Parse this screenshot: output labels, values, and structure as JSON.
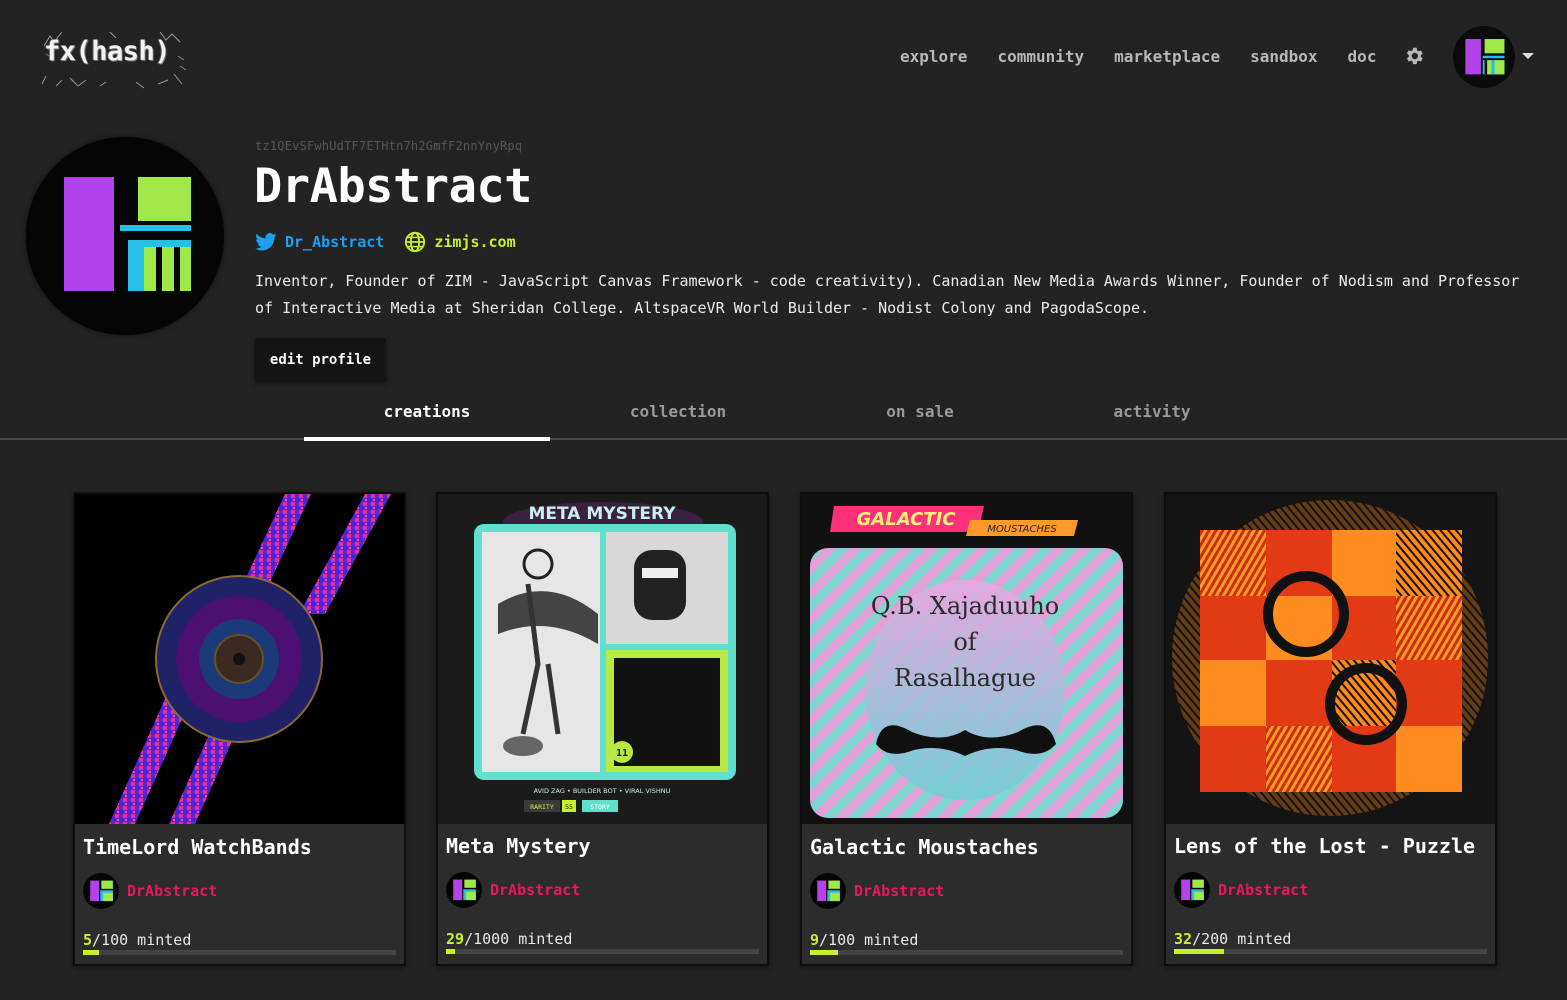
{
  "header": {
    "logo_text": "fx(hash)",
    "nav": [
      "explore",
      "community",
      "marketplace",
      "sandbox",
      "doc"
    ]
  },
  "profile": {
    "address": "tz1QEvSFwhUdTF7ETHtn7h2GmfF2nnYnyRpq",
    "name": "DrAbstract",
    "twitter": "Dr_Abstract",
    "website": "zimjs.com",
    "bio": "Inventor, Founder of ZIM - JavaScript Canvas Framework - code creativity). Canadian New Media Awards Winner, Founder of Nodism and Professor of Interactive Media at Sheridan College. AltspaceVR World Builder - Nodist Colony and PagodaScope.",
    "edit_label": "edit profile"
  },
  "tabs": [
    "creations",
    "collection",
    "on sale",
    "activity"
  ],
  "active_tab": "creations",
  "colors": {
    "accent_lime": "#c7f12e",
    "author_pink": "#e9185a",
    "twitter_blue": "#1da1f2",
    "avatar_purple": "#b342e8",
    "avatar_green": "#9ee84a",
    "avatar_cyan": "#25bfe8"
  },
  "cards": [
    {
      "title": "TimeLord WatchBands",
      "author": "DrAbstract",
      "minted": "5",
      "supply": "/100",
      "minted_suffix": " minted",
      "progress": 0.05,
      "art": "watch"
    },
    {
      "title": "Meta Mystery",
      "author": "DrAbstract",
      "minted": "29",
      "supply": "/1000",
      "minted_suffix": " minted",
      "progress": 0.029,
      "art": "comic",
      "art_text": {
        "heading": "META MYSTERY",
        "credits": "AVID ZAG  •  BUILDER BOT  •  VIRAL VISHNU",
        "rarity": "RARITY",
        "rarity_value": "55",
        "story": "STORY",
        "page_left": "11",
        "page_right": "11"
      }
    },
    {
      "title": "Galactic Moustaches",
      "author": "DrAbstract",
      "minted": "9",
      "supply": "/100",
      "minted_suffix": " minted",
      "progress": 0.09,
      "art": "moustache",
      "art_text": {
        "heading": "GALACTIC",
        "subheading": "MOUSTACHES",
        "line1": "Q.B. Xajaduuho",
        "line2": "of",
        "line3": "Rasalhague"
      }
    },
    {
      "title": "Lens of the Lost - Puzzle",
      "author": "DrAbstract",
      "minted": "32",
      "supply": "/200",
      "minted_suffix": " minted",
      "progress": 0.16,
      "art": "puzzle"
    }
  ]
}
